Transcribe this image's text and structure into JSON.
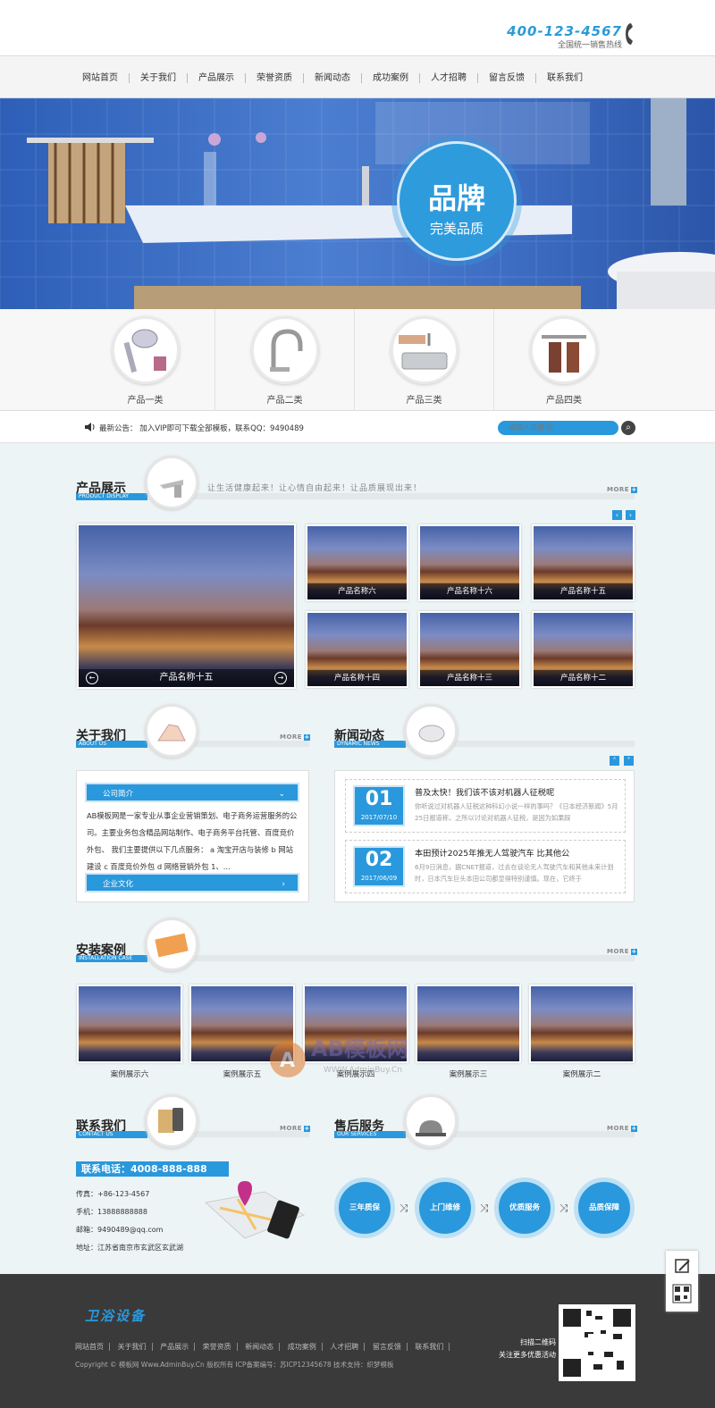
{
  "header": {
    "phone": "400-123-4567",
    "hotline_label": "全国统一销售热线"
  },
  "nav": {
    "items": [
      "网站首页",
      "关于我们",
      "产品展示",
      "荣誉资质",
      "新闻动态",
      "成功案例",
      "人才招聘",
      "留言反馈",
      "联系我们"
    ]
  },
  "banner": {
    "title": "品牌",
    "subtitle": "完美品质"
  },
  "categories": [
    {
      "label": "产品一类",
      "icon": "shower-head-icon"
    },
    {
      "label": "产品二类",
      "icon": "faucet-icon"
    },
    {
      "label": "产品三类",
      "icon": "sink-icon"
    },
    {
      "label": "产品四类",
      "icon": "towel-hook-icon"
    }
  ],
  "notice": {
    "text": "最新公告：  加入VIP即可下载全部模板，联系QQ：9490489",
    "search_placeholder": "请输入关键词!"
  },
  "products": {
    "title": "产品展示",
    "subtitle": "PRODUCT DISPLAY",
    "slogan": "让生活健康起来！让心情自由起来！让品质展现出来！",
    "more": "MORE",
    "featured": "产品名称十五",
    "items": [
      "产品名称六",
      "产品名称十六",
      "产品名称十五",
      "产品名称十四",
      "产品名称十三",
      "产品名称十二"
    ]
  },
  "about": {
    "title": "关于我们",
    "subtitle": "ABOUT US",
    "more": "MORE",
    "tab1": "公司简介",
    "text": "AB模板网是一家专业从事企业营销策划、电子商务运营服务的公司。主要业务包含精品网站制作、电子商务平台托管、百度竞价外包、 我们主要提供以下几点服务： a 淘宝开店与装修 b 网站建设 c 百度竞价外包 d 网络营销外包 1、...",
    "tab2": "企业文化"
  },
  "news": {
    "title": "新闻动态",
    "subtitle": "DYNAMIC NEWS",
    "items": [
      {
        "day": "01",
        "ym": "2017/07/10",
        "title": "普及太快！我们该不该对机器人征税呢",
        "desc": "你听说过对机器人征税这种科幻小说一样的事吗？《日本经济新闻》5月25日报道称，之所以讨论对机器人征税，是因为如果踩"
      },
      {
        "day": "02",
        "ym": "2017/06/09",
        "title": "本田预计2025年推无人驾驶汽车 比其他公",
        "desc": "6月9日消息，据CNET报道，过去在谈论无人驾驶汽车和其他未来计划时，日本汽车巨头本田公司都显得特别谨慎。现在，它终于"
      }
    ]
  },
  "cases": {
    "title": "安装案例",
    "subtitle": "INSTALLATION CASE",
    "more": "MORE",
    "items": [
      "案例展示六",
      "案例展示五",
      "案例展示四",
      "案例展示三",
      "案例展示二"
    ]
  },
  "watermark": {
    "brand": "AB模板网",
    "url": "WWW.AdminBuy.Cn"
  },
  "contact": {
    "title": "联系我们",
    "subtitle": "CONTACT US",
    "more": "MORE",
    "tel_label": "联系电话：4008-888-888",
    "fax": "传真：+86-123-4567",
    "mobile": "手机：13888888888",
    "email": "邮箱：9490489@qq.com",
    "address": "地址：江苏省南京市玄武区玄武湖"
  },
  "service": {
    "title": "售后服务",
    "subtitle": "OUR SERVICES",
    "more": "MORE",
    "items": [
      "三年质保",
      "上门维修",
      "优质服务",
      "品质保障"
    ]
  },
  "footer": {
    "logo": "卫浴设备",
    "nav": [
      "网站首页",
      "关于我们",
      "产品展示",
      "荣誉资质",
      "新闻动态",
      "成功案例",
      "人才招聘",
      "留言反馈",
      "联系我们"
    ],
    "copyright": "Copyright © 模板网 Www.AdminBuy.Cn 版权所有     ICP备案编号：苏ICP12345678     技术支持：织梦模板",
    "qr_line1": "扫描二维码",
    "qr_line2": "关注更多优惠活动"
  },
  "colors": {
    "accent": "#2a98dc",
    "footer_bg": "#3a3a3a",
    "page_bg": "#edf4f6"
  }
}
